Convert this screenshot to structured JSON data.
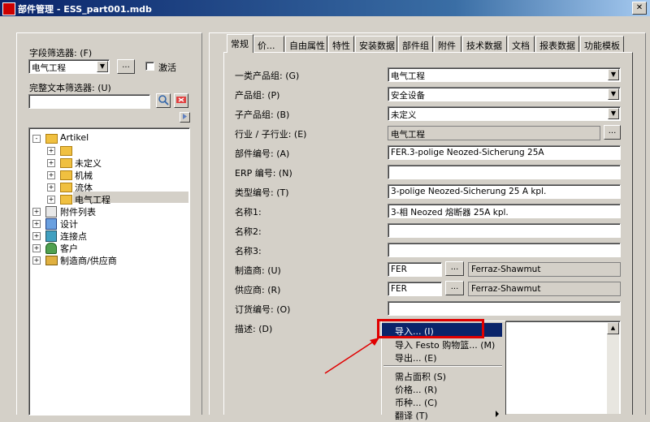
{
  "window": {
    "title": "部件管理 - ESS_part001.mdb"
  },
  "filter": {
    "field_label": "字段筛选器: (F)",
    "field_value": "电气工程",
    "more_label": "...",
    "active_label": "激活",
    "fulltext_label": "完整文本筛选器: (U)",
    "fulltext_value": ""
  },
  "tree": {
    "root": "Artikel",
    "children": [
      "",
      "未定义",
      "机械",
      "流体",
      "电气工程"
    ],
    "groups": [
      "附件列表",
      "设计",
      "连接点",
      "客户",
      "制造商/供应商"
    ]
  },
  "tabs": [
    "常规",
    "价...",
    "自由属性",
    "特性",
    "安装数据",
    "部件组",
    "附件",
    "技术数据",
    "文档",
    "报表数据",
    "功能模板"
  ],
  "form": {
    "product_group1_label": "一类产品组: (G)",
    "product_group1_value": "电气工程",
    "product_group_label": "产品组: (P)",
    "product_group_value": "安全设备",
    "sub_product_group_label": "子产品组: (B)",
    "sub_product_group_value": "未定义",
    "industry_label": "行业 / 子行业: (E)",
    "industry_value": "电气工程",
    "part_number_label": "部件编号: (A)",
    "part_number_value": "FER.3-polige Neozed-Sicherung 25A",
    "erp_label": "ERP 编号: (N)",
    "erp_value": "",
    "type_number_label": "类型编号: (T)",
    "type_number_value": "3-polige Neozed-Sicherung 25 A kpl.",
    "name1_label": "名称1:",
    "name1_value": "3-相 Neozed 熔断器 25A kpl.",
    "name2_label": "名称2:",
    "name2_value": "",
    "name3_label": "名称3:",
    "name3_value": "",
    "manufacturer_label": "制造商: (U)",
    "manufacturer_code": "FER",
    "manufacturer_name": "Ferraz-Shawmut",
    "supplier_label": "供应商: (R)",
    "supplier_code": "FER",
    "supplier_name": "Ferraz-Shawmut",
    "order_number_label": "订货编号: (O)",
    "order_number_value": "",
    "description_label": "描述: (D)",
    "ellipsis": "..."
  },
  "context_menu": {
    "items": [
      "导入... (I)",
      "导入 Festo 购物篮... (M)",
      "导出... (E)",
      "需占面积 (S)",
      "价格... (R)",
      "币种... (C)",
      "翻译 (T)"
    ]
  },
  "colors": {
    "highlight": "#0a246a",
    "annotation": "#e00000"
  }
}
